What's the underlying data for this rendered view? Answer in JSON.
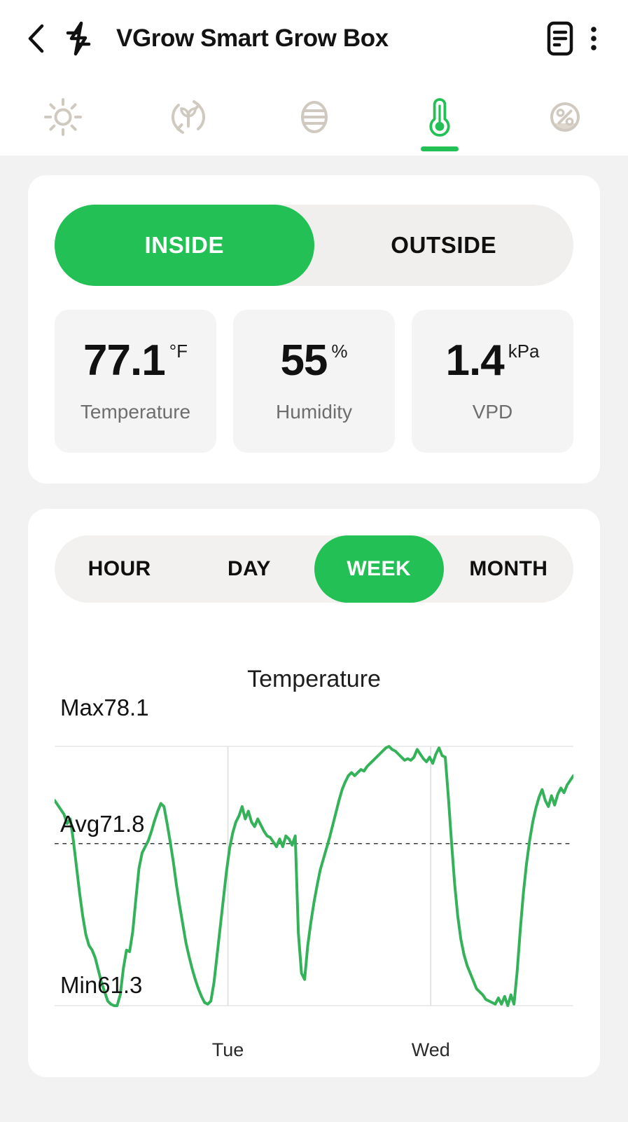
{
  "header": {
    "title": "VGrow Smart Grow Box",
    "back_icon": "chevron-left-icon",
    "bolt_icon": "lightning-bolt-icon",
    "doc_icon": "document-list-icon",
    "more_icon": "overflow-menu-icon"
  },
  "tabs": [
    {
      "id": "light",
      "icon": "sun-icon",
      "active": false
    },
    {
      "id": "grow",
      "icon": "plant-cycle-icon",
      "active": false
    },
    {
      "id": "fan",
      "icon": "airflow-icon",
      "active": false
    },
    {
      "id": "temp",
      "icon": "thermometer-icon",
      "active": true
    },
    {
      "id": "humidity",
      "icon": "percent-icon",
      "active": false
    }
  ],
  "location_toggle": {
    "options": [
      "INSIDE",
      "OUTSIDE"
    ],
    "selected": "INSIDE"
  },
  "metrics": [
    {
      "value": "77.1",
      "unit": "°F",
      "label": "Temperature"
    },
    {
      "value": "55",
      "unit": "%",
      "label": "Humidity"
    },
    {
      "value": "1.4",
      "unit": "kPa",
      "label": "VPD"
    }
  ],
  "range_toggle": {
    "options": [
      "HOUR",
      "DAY",
      "WEEK",
      "MONTH"
    ],
    "selected": "WEEK"
  },
  "colors": {
    "accent_green": "#22c055",
    "line_green": "#34b25a",
    "tile_grey": "#f4f4f4",
    "track_grey": "#f0efed"
  },
  "chart_data": {
    "type": "line",
    "title": "Temperature",
    "xlabel": "",
    "ylabel": "",
    "unit": "°F",
    "grid": true,
    "legend": false,
    "stat_labels": {
      "max": "Max78.1",
      "avg": "Avg71.8",
      "min": "Min61.3"
    },
    "max": 78.1,
    "avg": 71.8,
    "min": 61.3,
    "ylim": [
      61.3,
      78.1
    ],
    "tick_labels": [
      "Tue",
      "Wed"
    ],
    "tick_positions_pct": [
      33.4,
      72.5
    ],
    "series": [
      {
        "name": "Temperature",
        "values": [
          74.6,
          74.3,
          74.0,
          73.7,
          73.1,
          73.4,
          72.0,
          70.3,
          68.6,
          67.1,
          65.9,
          65.2,
          64.9,
          64.4,
          63.6,
          62.8,
          62.2,
          61.6,
          61.4,
          61.3,
          61.3,
          62.0,
          63.7,
          64.9,
          64.8,
          66.1,
          68.2,
          70.2,
          71.2,
          71.6,
          72.0,
          72.6,
          73.3,
          73.9,
          74.4,
          74.2,
          73.1,
          71.9,
          70.6,
          69.1,
          67.8,
          66.6,
          65.4,
          64.5,
          63.7,
          63.0,
          62.4,
          61.9,
          61.5,
          61.4,
          61.6,
          62.8,
          64.6,
          66.4,
          68.2,
          70.0,
          71.5,
          72.5,
          73.2,
          73.6,
          74.2,
          73.4,
          73.9,
          73.2,
          72.9,
          73.4,
          73.0,
          72.6,
          72.3,
          72.2,
          71.9,
          71.6,
          72.1,
          71.6,
          72.3,
          72.1,
          71.7,
          72.3,
          66.0,
          63.4,
          63.0,
          65.2,
          66.7,
          68.0,
          69.1,
          70.1,
          70.8,
          71.5,
          72.2,
          73.0,
          73.8,
          74.6,
          75.3,
          75.8,
          76.2,
          76.4,
          76.2,
          76.4,
          76.6,
          76.5,
          76.8,
          77.0,
          77.2,
          77.4,
          77.6,
          77.8,
          78.0,
          78.1,
          77.9,
          77.8,
          77.6,
          77.4,
          77.2,
          77.3,
          77.2,
          77.4,
          77.9,
          77.6,
          77.3,
          77.1,
          77.4,
          77.0,
          77.6,
          78.0,
          77.5,
          77.4,
          74.8,
          71.9,
          69.2,
          67.1,
          65.6,
          64.6,
          63.9,
          63.4,
          62.9,
          62.4,
          62.2,
          62.0,
          61.7,
          61.6,
          61.5,
          61.4,
          61.8,
          61.4,
          61.9,
          61.3,
          62.0,
          61.4,
          63.5,
          66.2,
          68.6,
          70.5,
          72.0,
          73.2,
          74.1,
          74.8,
          75.3,
          74.6,
          74.2,
          74.9,
          74.3,
          75.0,
          75.4,
          75.1,
          75.6,
          75.9,
          76.2
        ]
      }
    ]
  }
}
